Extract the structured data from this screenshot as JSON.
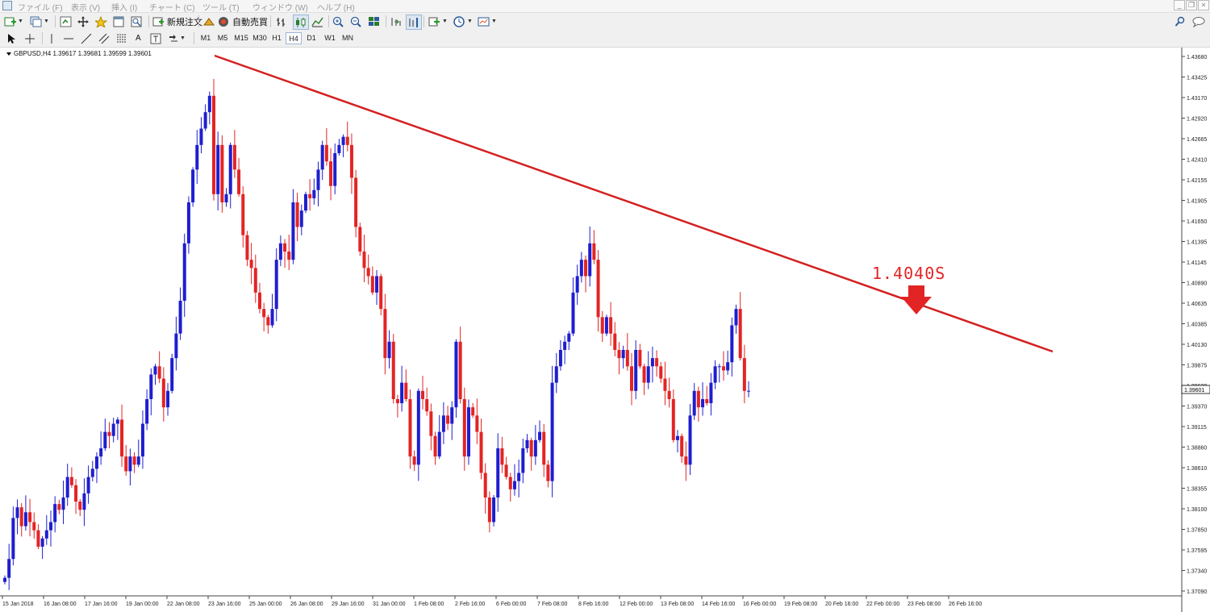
{
  "menu": [
    "ファイル (F)",
    "表示 (V)",
    "挿入 (I)",
    "チャート (C)",
    "ツール (T)",
    "ウィンドウ (W)",
    "ヘルプ (H)"
  ],
  "toolbar": {
    "new_order": "新規注文",
    "auto_trade": "自動売買"
  },
  "timeframes": [
    "M1",
    "M5",
    "M15",
    "M30",
    "H1",
    "H4",
    "D1",
    "W1",
    "MN"
  ],
  "active_timeframe": "H4",
  "chart": {
    "header": "GBPUSD,H4  1.39617 1.39681 1.39599 1.39601",
    "current_price": "1.39601",
    "annotation": "1.4040S",
    "colors": {
      "bull": "#1e1ecf",
      "bear": "#e32424",
      "trendline": "#d42020",
      "arrow": "#e32424"
    }
  },
  "chart_data": {
    "type": "candlestick",
    "symbol": "GBPUSD",
    "timeframe": "H4",
    "ohlc_last": {
      "open": 1.39617,
      "high": 1.39681,
      "low": 1.39599,
      "close": 1.39601
    },
    "y_tick_labels": [
      "1.43680",
      "1.43425",
      "1.43170",
      "1.42920",
      "1.42665",
      "1.42410",
      "1.42155",
      "1.41905",
      "1.41650",
      "1.41395",
      "1.41145",
      "1.40890",
      "1.40635",
      "1.40385",
      "1.40130",
      "1.39875",
      "1.39620",
      "1.39370",
      "1.39115",
      "1.38860",
      "1.38610",
      "1.38355",
      "1.38100",
      "1.37850",
      "1.37595",
      "1.37340",
      "1.37090"
    ],
    "ylim": [
      1.3709,
      1.4368
    ],
    "x_tick_labels": [
      "15 Jan 2018",
      "16 Jan 08:00",
      "17 Jan 16:00",
      "19 Jan 00:00",
      "22 Jan 08:00",
      "23 Jan 16:00",
      "25 Jan 00:00",
      "26 Jan 08:00",
      "29 Jan 16:00",
      "31 Jan 00:00",
      "1 Feb 08:00",
      "2 Feb 16:00",
      "6 Feb 00:00",
      "7 Feb 08:00",
      "8 Feb 16:00",
      "12 Feb 00:00",
      "13 Feb 08:00",
      "14 Feb 16:00",
      "16 Feb 00:00",
      "19 Feb 08:00",
      "20 Feb 16:00",
      "22 Feb 00:00",
      "23 Feb 08:00",
      "26 Feb 16:00"
    ],
    "closes": [
      1.3732,
      1.3755,
      1.3805,
      1.3818,
      1.3795,
      1.3812,
      1.38,
      1.379,
      1.377,
      1.378,
      1.379,
      1.38,
      1.3822,
      1.3815,
      1.383,
      1.3855,
      1.3845,
      1.3825,
      1.3815,
      1.3835,
      1.3855,
      1.3865,
      1.388,
      1.389,
      1.391,
      1.3905,
      1.392,
      1.3925,
      1.388,
      1.3862,
      1.388,
      1.387,
      1.388,
      1.392,
      1.395,
      1.398,
      1.399,
      1.3975,
      1.394,
      1.396,
      1.4,
      1.403,
      1.407,
      1.414,
      1.419,
      1.423,
      1.426,
      1.428,
      1.43,
      1.432,
      1.42,
      1.426,
      1.419,
      1.42,
      1.426,
      1.423,
      1.42,
      1.415,
      1.412,
      1.411,
      1.408,
      1.406,
      1.405,
      1.404,
      1.406,
      1.412,
      1.414,
      1.413,
      1.412,
      1.419,
      1.416,
      1.418,
      1.42,
      1.4195,
      1.4205,
      1.423,
      1.426,
      1.424,
      1.421,
      1.425,
      1.426,
      1.427,
      1.426,
      1.422,
      1.416,
      1.413,
      1.411,
      1.41,
      1.408,
      1.41,
      1.406,
      1.4,
      1.402,
      1.395,
      1.3945,
      1.397,
      1.395,
      1.388,
      1.387,
      1.396,
      1.395,
      1.3935,
      1.3905,
      1.388,
      1.391,
      1.393,
      1.392,
      1.394,
      1.402,
      1.395,
      1.388,
      1.394,
      1.393,
      1.391,
      1.386,
      1.383,
      1.38,
      1.383,
      1.389,
      1.387,
      1.3855,
      1.384,
      1.385,
      1.386,
      1.389,
      1.39,
      1.388,
      1.39,
      1.391,
      1.387,
      1.385,
      1.397,
      1.399,
      1.401,
      1.402,
      1.403,
      1.408,
      1.41,
      1.412,
      1.41,
      1.414,
      1.412,
      1.405,
      1.403,
      1.405,
      1.403,
      1.401,
      1.4,
      1.401,
      1.399,
      1.396,
      1.401,
      1.399,
      1.397,
      1.399,
      1.4,
      1.399,
      1.3975,
      1.396,
      1.395,
      1.39,
      1.3905,
      1.388,
      1.387,
      1.393,
      1.396,
      1.394,
      1.395,
      1.3945,
      1.397,
      1.399,
      1.399,
      1.3985,
      1.3995,
      1.404,
      1.406,
      1.4,
      1.396,
      1.39601
    ]
  }
}
